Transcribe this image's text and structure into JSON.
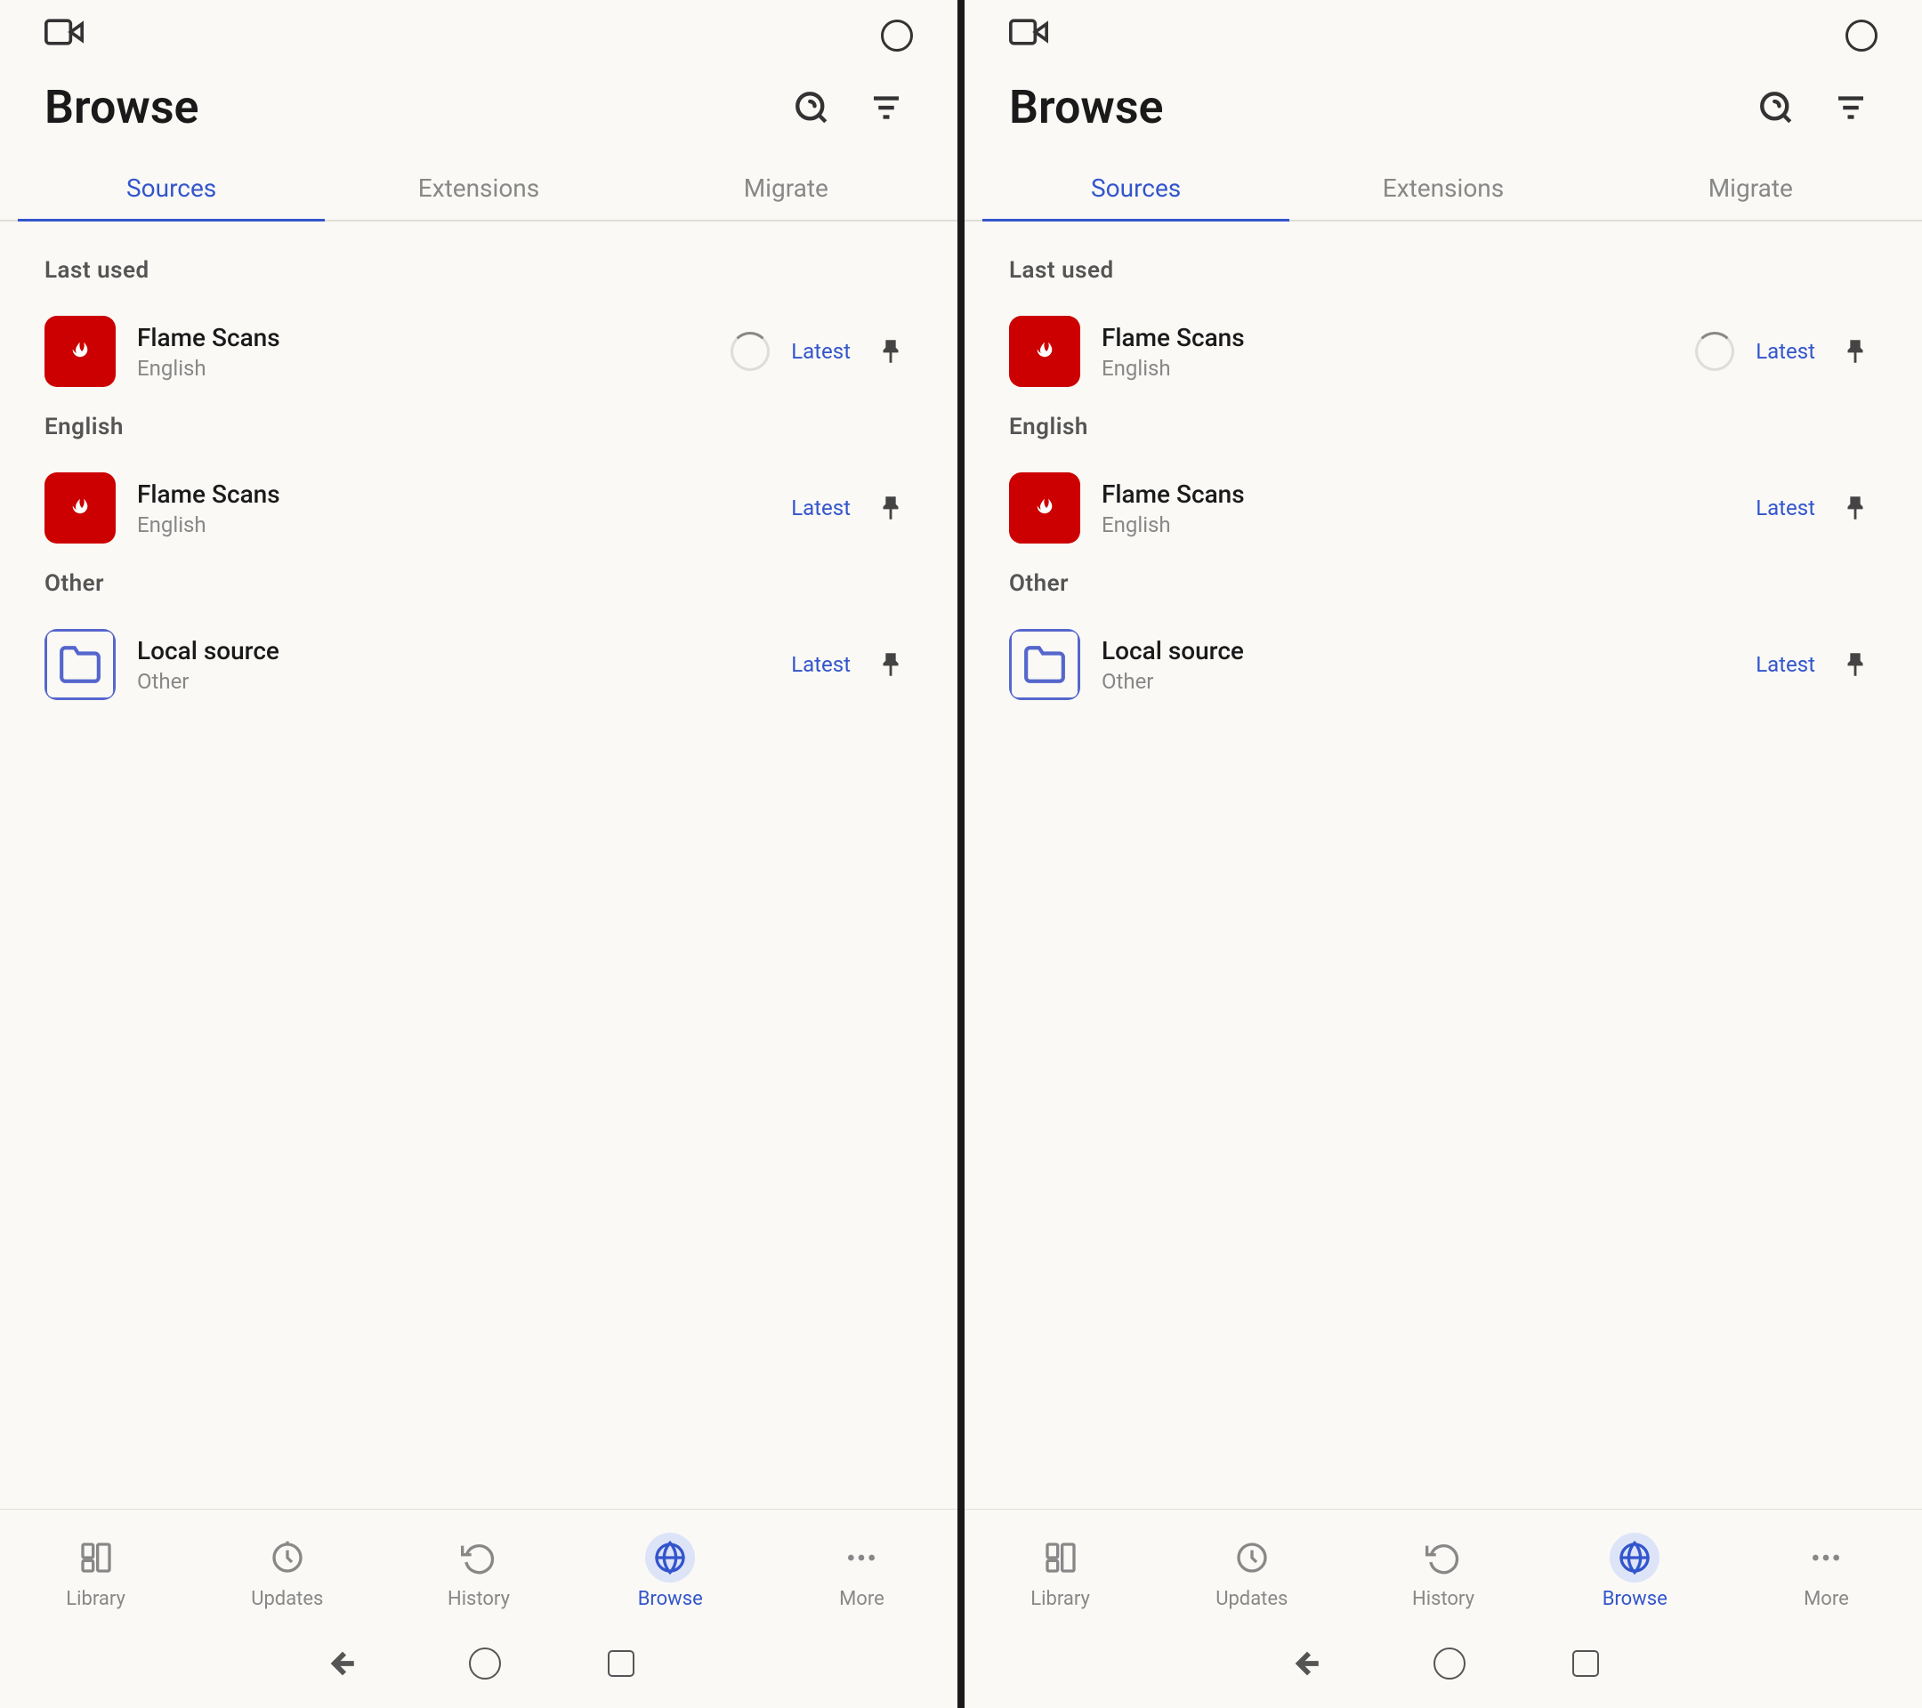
{
  "screens": [
    {
      "id": "left",
      "header": {
        "title": "Browse",
        "search_icon": "search-icon",
        "filter_icon": "filter-icon"
      },
      "tabs": [
        {
          "label": "Sources",
          "active": true
        },
        {
          "label": "Extensions",
          "active": false
        },
        {
          "label": "Migrate",
          "active": false
        }
      ],
      "sections": [
        {
          "label": "Last used",
          "items": [
            {
              "name": "Flame Scans",
              "lang": "English",
              "badge": "Latest",
              "icon_type": "flame",
              "loading": true
            }
          ]
        },
        {
          "label": "English",
          "items": [
            {
              "name": "Flame Scans",
              "lang": "English",
              "badge": "Latest",
              "icon_type": "flame",
              "loading": false
            }
          ]
        },
        {
          "label": "Other",
          "items": [
            {
              "name": "Local source",
              "lang": "Other",
              "badge": "Latest",
              "icon_type": "local",
              "loading": false
            }
          ]
        }
      ],
      "bottom_nav": [
        {
          "label": "Library",
          "icon": "library-icon",
          "active": false
        },
        {
          "label": "Updates",
          "icon": "updates-icon",
          "active": false
        },
        {
          "label": "History",
          "icon": "history-icon",
          "active": false
        },
        {
          "label": "Browse",
          "icon": "browse-icon",
          "active": true
        },
        {
          "label": "More",
          "icon": "more-icon",
          "active": false
        }
      ]
    },
    {
      "id": "right",
      "header": {
        "title": "Browse",
        "search_icon": "search-icon",
        "filter_icon": "filter-icon"
      },
      "tabs": [
        {
          "label": "Sources",
          "active": true
        },
        {
          "label": "Extensions",
          "active": false
        },
        {
          "label": "Migrate",
          "active": false
        }
      ],
      "sections": [
        {
          "label": "Last used",
          "items": [
            {
              "name": "Flame Scans",
              "lang": "English",
              "badge": "Latest",
              "icon_type": "flame",
              "loading": true
            }
          ]
        },
        {
          "label": "English",
          "items": [
            {
              "name": "Flame Scans",
              "lang": "English",
              "badge": "Latest",
              "icon_type": "flame",
              "loading": false
            }
          ]
        },
        {
          "label": "Other",
          "items": [
            {
              "name": "Local source",
              "lang": "Other",
              "badge": "Latest",
              "icon_type": "local",
              "loading": false
            }
          ]
        }
      ],
      "bottom_nav": [
        {
          "label": "Library",
          "icon": "library-icon",
          "active": false
        },
        {
          "label": "Updates",
          "icon": "updates-icon",
          "active": false
        },
        {
          "label": "History",
          "icon": "history-icon",
          "active": false
        },
        {
          "label": "Browse",
          "icon": "browse-icon",
          "active": true
        },
        {
          "label": "More",
          "icon": "more-icon",
          "active": false
        }
      ]
    }
  ]
}
